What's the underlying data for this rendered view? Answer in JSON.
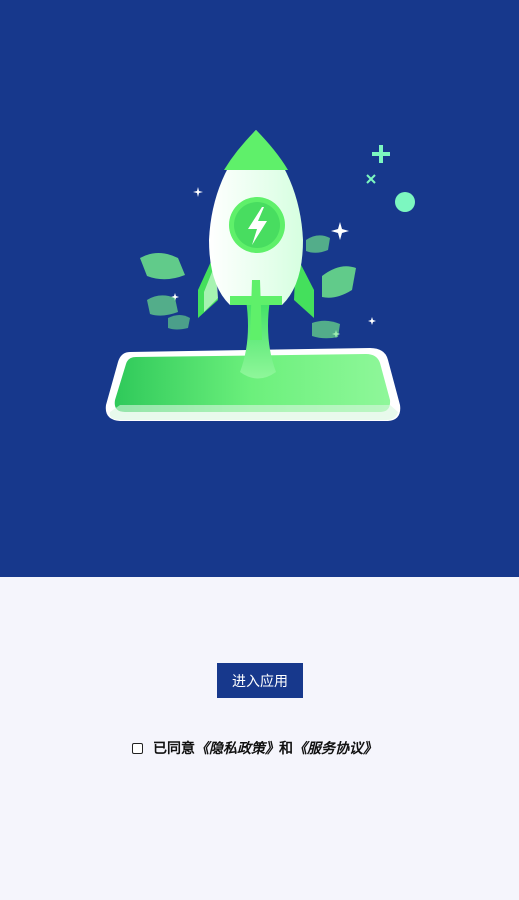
{
  "hero": {
    "illustration": "rocket-launch-illustration"
  },
  "actions": {
    "enter_label": "进入应用"
  },
  "agreement": {
    "prefix": "已同意",
    "privacy_link": "《隐私政策》",
    "conjunction": "和",
    "service_link": "《服务协议》",
    "checked": false
  },
  "colors": {
    "primary": "#17388c",
    "accent_green": "#5ff06a",
    "background": "#f5f5fc"
  }
}
